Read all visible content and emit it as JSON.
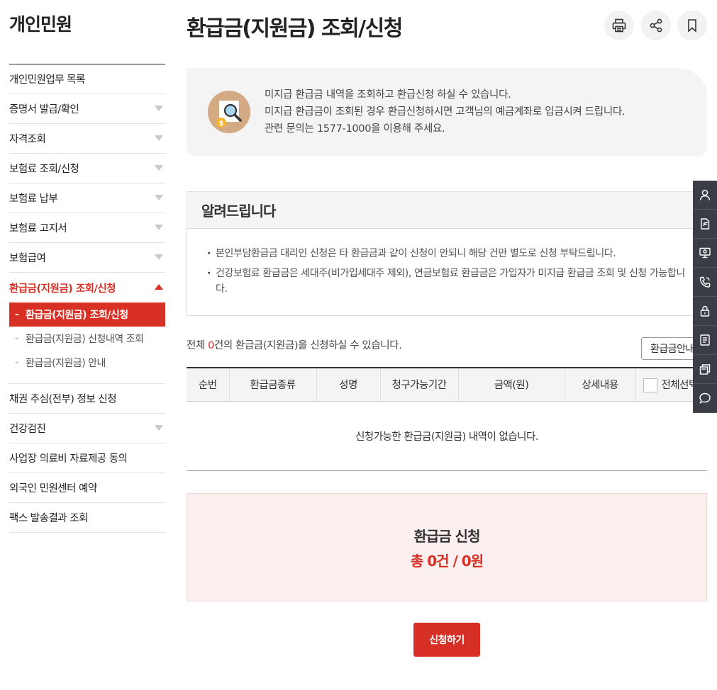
{
  "sidebar": {
    "title": "개인민원",
    "items": [
      {
        "label": "개인민원업무 목록"
      },
      {
        "label": "증명서 발급/확인"
      },
      {
        "label": "자격조회"
      },
      {
        "label": "보험료 조회/신청"
      },
      {
        "label": "보험료 납부"
      },
      {
        "label": "보험료 고지서"
      },
      {
        "label": "보험급여"
      },
      {
        "label": "환급금(지원금) 조회/신청"
      },
      {
        "label": "채권 추심(전부) 정보 신청"
      },
      {
        "label": "건강검진"
      },
      {
        "label": "사업장 의료비 자료제공 동의"
      },
      {
        "label": "외국인 민원센터 예약"
      },
      {
        "label": "팩스 발송결과 조회"
      }
    ],
    "sub_items": [
      {
        "label": "환급금(지원금) 조회/신청"
      },
      {
        "label": "환급금(지원금) 신청내역 조회"
      },
      {
        "label": "환급금(지원금) 안내"
      }
    ],
    "sub_dash": "-"
  },
  "header": {
    "title": "환급금(지원금) 조회/신청",
    "tools": [
      "print-icon",
      "share-icon",
      "bookmark-icon"
    ]
  },
  "intro": {
    "icon": "magnifier-coin-icon",
    "lines": [
      "미지급 환급금 내역을 조회하고 환급신청 하실 수 있습니다.",
      "미지급 환급금이 조회된 경우 환급신청하시면 고객님의 예금계좌로 입금시켜 드립니다.",
      "관련 문의는 1577-1000을 이용해 주세요."
    ]
  },
  "notice": {
    "title": "알려드립니다",
    "items": [
      "본인부담환급금 대리인 신청은 타 환급금과 같이 신청이 안되니 해당 건만 별도로 신청 부탁드립니다.",
      "건강보험료 환급금은 세대주(비가입세대주 제외), 연금보험료 환급금은 가입자가 미지급 환급금 조회 및 신청 가능합니다."
    ]
  },
  "count": {
    "prefix": "전체 ",
    "number": "0",
    "suffix": "건의 환급금(지원금)을 신청하실 수 있습니다."
  },
  "guide_button": "환급금안내",
  "table": {
    "headers": [
      "순번",
      "환급금종류",
      "성명",
      "청구가능기간",
      "금액(원)",
      "상세내용",
      "전체선택"
    ],
    "empty_message": "신청가능한 환급금(지원금) 내역이 없습니다."
  },
  "summary": {
    "title": "환급금 신청",
    "total": "총 0건 / 0원"
  },
  "apply_button": "신청하기",
  "quick_menu": [
    "person-icon",
    "document-icon",
    "monitor-icon",
    "phone-icon",
    "lock-icon",
    "list-icon",
    "copy-icon",
    "chat-icon"
  ],
  "colors": {
    "accent": "#d93025",
    "quick_bg": "#3a3d45"
  }
}
